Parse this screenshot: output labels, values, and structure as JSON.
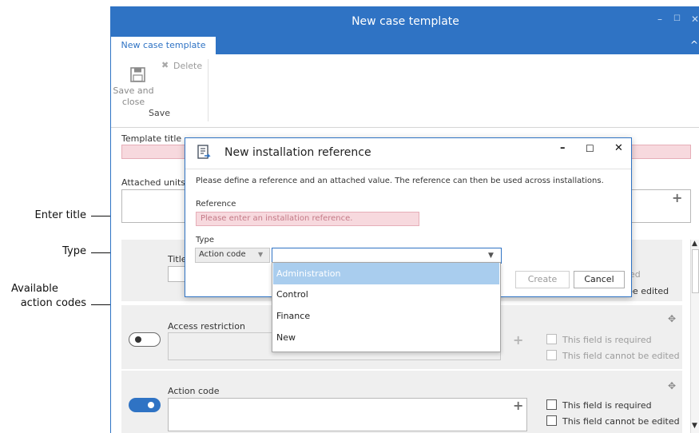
{
  "window": {
    "title": "New case template",
    "minimize_glyph": "–",
    "maximize_glyph": "☐",
    "close_glyph": "✕"
  },
  "ribbon": {
    "tab_label": "New case template",
    "collapse_glyph": "^",
    "save_close_label_line1": "Save and",
    "save_close_label_line2": "close",
    "delete_label": "Delete",
    "group_label": "Save",
    "icons": {
      "save": "floppy-disk-icon",
      "delete": "delete-x-icon"
    }
  },
  "form": {
    "template_title_label": "Template title",
    "attached_units_label": "Attached units",
    "plus_glyph": "+",
    "title_label": "Title",
    "access_restriction_label": "Access restriction",
    "action_code_label": "Action code",
    "field_required_label": "This field is required",
    "field_cannot_edit_label": "This field cannot be edited",
    "partial_required": "ed",
    "partial_edited": "pe edited"
  },
  "dialog": {
    "title": "New installation reference",
    "description": "Please define a reference and an attached value. The reference can then be used across installations.",
    "reference_label": "Reference",
    "reference_placeholder": "Please enter an installation reference.",
    "type_label": "Type",
    "type_value": "Action code",
    "create_label": "Create",
    "cancel_label": "Cancel",
    "minimize_glyph": "–",
    "maximize_glyph": "☐",
    "close_glyph": "✕"
  },
  "dropdown": {
    "options": [
      "Administration",
      "Control",
      "Finance",
      "New"
    ],
    "highlighted": "Administration"
  },
  "callouts": {
    "enter_title": "Enter title",
    "type": "Type",
    "available_line1": "Available",
    "available_line2": "action codes"
  },
  "colors": {
    "accent": "#2f73c4",
    "required_fill": "#f7d9de",
    "highlight": "#a9cdee"
  }
}
